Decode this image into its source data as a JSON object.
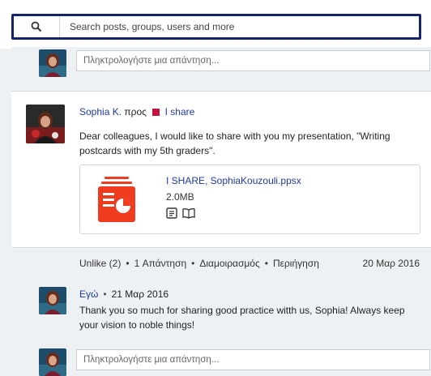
{
  "search": {
    "placeholder": "Search posts, groups, users and more"
  },
  "reply_top": {
    "placeholder": "Πληκτρολογήστε μια απάντηση..."
  },
  "post": {
    "author": "Sophia K.",
    "to_label": "προς",
    "group": "I share",
    "group_color": "#c4113d",
    "body": "Dear colleagues, I would like to share with you my presentation, \"Writing postcards with my 5th graders\".",
    "attachment": {
      "name": "I SHARE, SophiaKouzouli.ppsx",
      "size": "2.0MB",
      "icon": "presentation-file-icon",
      "icon_color": "#ef3b1e"
    }
  },
  "actions": {
    "unlike": "Unlike (2)",
    "reply": "1 Απάντηση",
    "share": "Διαμοιρασμός",
    "navigate": "Περιήγηση",
    "date": "20 Μαρ 2016"
  },
  "comment": {
    "author": "Εγώ",
    "date": "21 Μαρ 2016",
    "text": "Thank you so much for sharing good practice witth us, Sophia! Always keep your vision to noble things!"
  },
  "reply_bottom": {
    "placeholder": "Πληκτρολογήστε μια απάντηση..."
  }
}
